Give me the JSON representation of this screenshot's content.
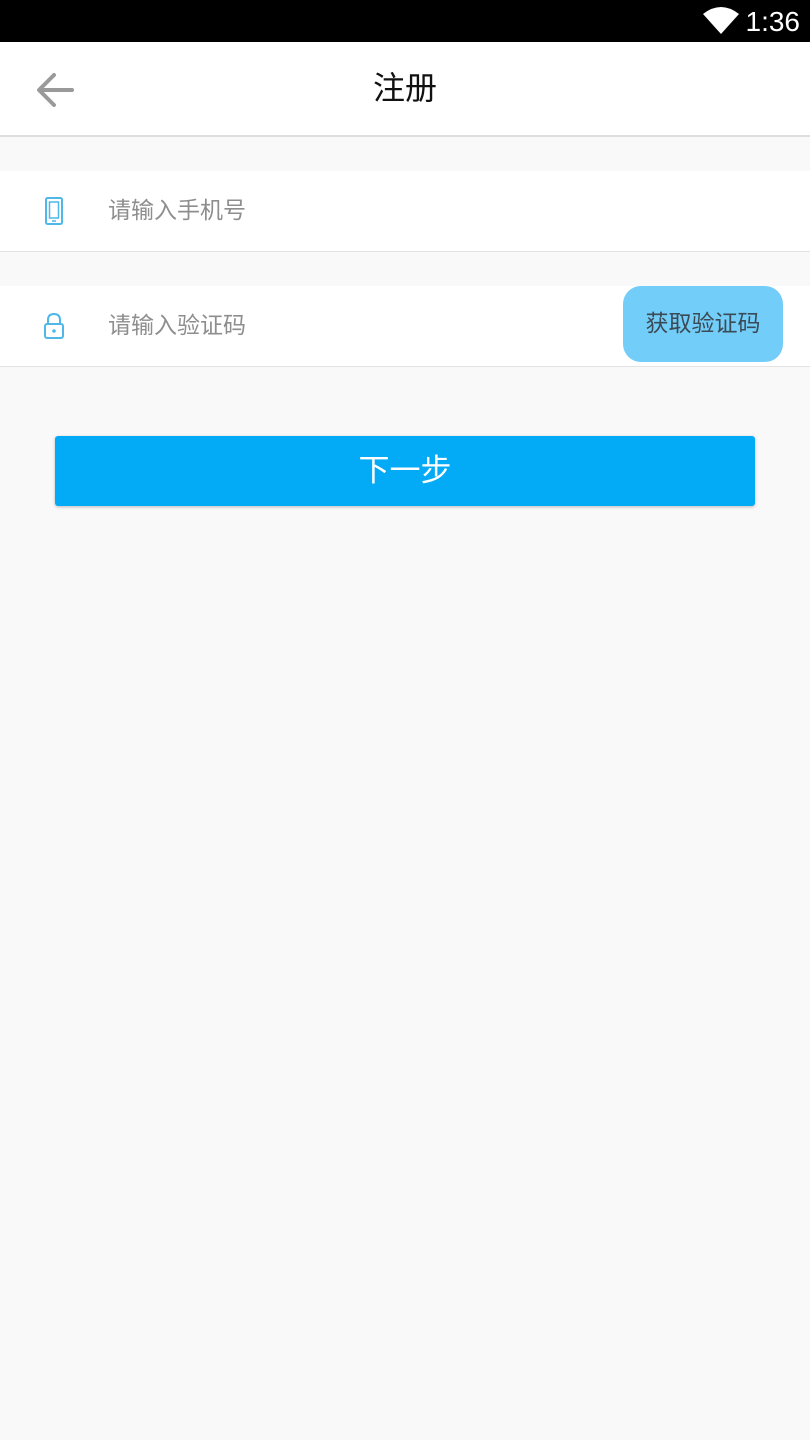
{
  "status_bar": {
    "time": "1:36",
    "icons": [
      "wifi-icon"
    ]
  },
  "header": {
    "back_icon": "arrow-left-icon",
    "title": "注册"
  },
  "phone_field": {
    "icon": "phone-icon",
    "value": "",
    "placeholder": "请输入手机号"
  },
  "code_field": {
    "icon": "lock-icon",
    "value": "",
    "placeholder": "请输入验证码",
    "get_code_label": "获取验证码"
  },
  "next_button": {
    "label": "下一步"
  },
  "colors": {
    "accent": "#03aaf5",
    "code_button": "#73cdf9",
    "icon": "#4fb8e8",
    "background": "#f9f9f9"
  }
}
